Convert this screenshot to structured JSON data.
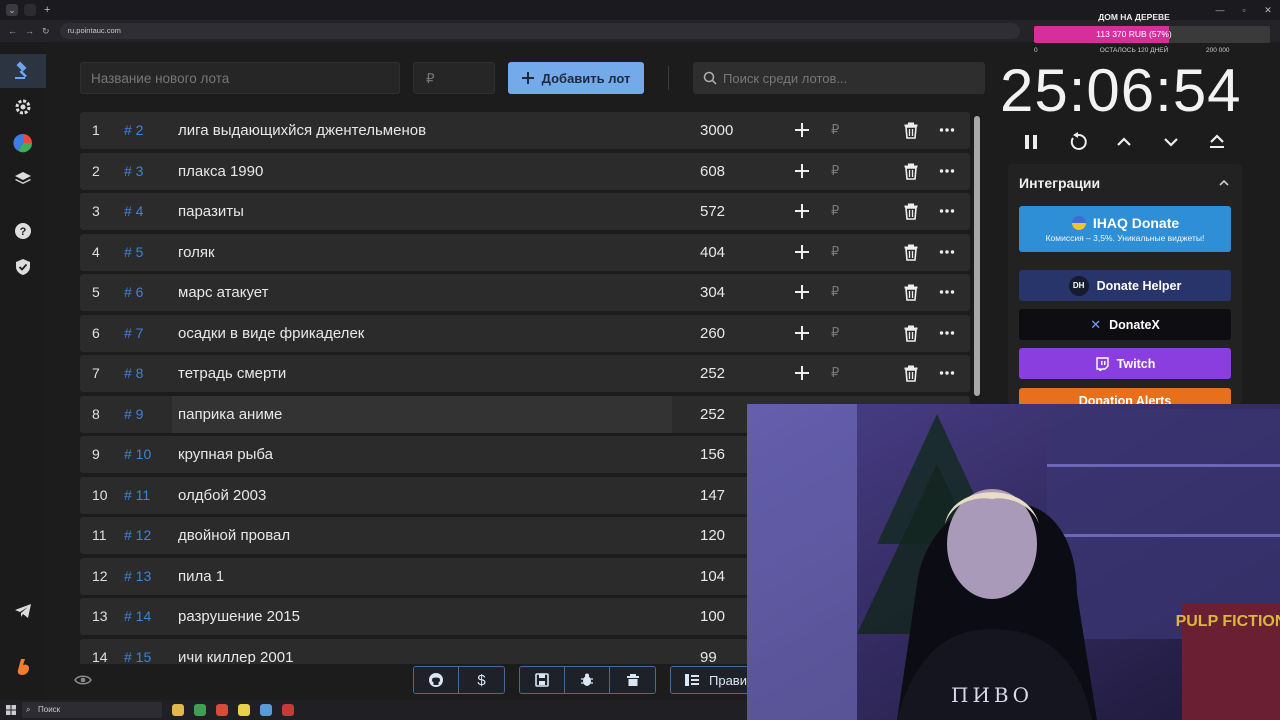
{
  "browser": {
    "url": "ru.pointauc.com"
  },
  "toolbar": {
    "lot_name_placeholder": "Название нового лота",
    "price_placeholder": "₽",
    "add_button": "Добавить лот",
    "search_placeholder": "Поиск среди лотов..."
  },
  "lots": [
    {
      "num": "1",
      "id": "# 2",
      "name": "лига выдающихйся джентельменов",
      "amount": "3000"
    },
    {
      "num": "2",
      "id": "# 3",
      "name": "плакса 1990",
      "amount": "608"
    },
    {
      "num": "3",
      "id": "# 4",
      "name": "паразиты",
      "amount": "572"
    },
    {
      "num": "4",
      "id": "# 5",
      "name": "голяк",
      "amount": "404"
    },
    {
      "num": "5",
      "id": "# 6",
      "name": "марс атакует",
      "amount": "304"
    },
    {
      "num": "6",
      "id": "# 7",
      "name": "осадки в виде фрикаделек",
      "amount": "260"
    },
    {
      "num": "7",
      "id": "# 8",
      "name": "тетрадь смерти",
      "amount": "252"
    },
    {
      "num": "8",
      "id": "# 9",
      "name": "паприка аниме",
      "amount": "252"
    },
    {
      "num": "9",
      "id": "# 10",
      "name": "крупная рыба",
      "amount": "156"
    },
    {
      "num": "10",
      "id": "# 11",
      "name": "олдбой 2003",
      "amount": "147"
    },
    {
      "num": "11",
      "id": "# 12",
      "name": " двойной провал",
      "amount": "120"
    },
    {
      "num": "12",
      "id": "# 13",
      "name": "пила 1",
      "amount": "104"
    },
    {
      "num": "13",
      "id": "# 14",
      "name": "разрушение 2015",
      "amount": "100"
    },
    {
      "num": "14",
      "id": "# 15",
      "name": "ичи киллер 2001",
      "amount": "99"
    }
  ],
  "row_currency": "₽",
  "bottom": {
    "rules_label": "Прави"
  },
  "goal": {
    "title": "ДОМ НА ДЕРЕВЕ",
    "progress_text": "113 370 RUB (57%)",
    "progress_fraction": 0.57,
    "min_label": "0",
    "remaining_label": "ОСТАЛОСЬ 120 ДНЕЙ",
    "max_label": "200 000",
    "fill_color": "#d62f9c"
  },
  "timer": {
    "value": "25:06:54"
  },
  "integrations": {
    "title": "Интеграции",
    "ihaq_title": "IHAQ Donate",
    "ihaq_subtitle": "Комиссия – 3,5%. Уникальные виджеты!",
    "donate_helper": "Donate Helper",
    "donate_helper_logo": "DH",
    "donatex": "DonateX",
    "twitch": "Twitch",
    "donation_alerts": "Donation Alerts"
  },
  "taskbar": {
    "search_label": "Поиск"
  },
  "colors": {
    "accent": "#74a9ea",
    "id_blue": "#3f83d6",
    "ihaq": "#2e8fd6",
    "donate_helper": "#27356a",
    "twitch": "#8a3ee0",
    "donation_alerts": "#e8701c"
  }
}
